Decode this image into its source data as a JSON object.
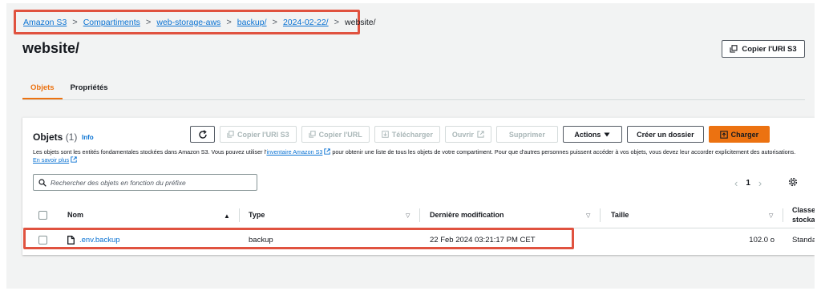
{
  "breadcrumb": {
    "items": [
      "Amazon S3",
      "Compartiments",
      "web-storage-aws",
      "backup/",
      "2024-02-22/"
    ],
    "current": "website/",
    "separator": ">"
  },
  "header": {
    "title": "website/",
    "copy_uri_label": "Copier l'URI S3"
  },
  "tabs": [
    {
      "label": "Objets",
      "active": true
    },
    {
      "label": "Propriétés",
      "active": false
    }
  ],
  "objects_panel": {
    "title": "Objets",
    "count": "(1)",
    "info_label": "Info",
    "description_before": "Les objets sont les entités fondamentales stockées dans Amazon S3. Vous pouvez utiliser l'",
    "inventory_link": "inventaire Amazon S3",
    "description_after": " pour obtenir une liste de tous les objets de votre compartiment. Pour que d'autres personnes puissent accéder à vos objets, vous devez leur accorder explicitement des autorisations.",
    "learn_more": "En savoir plus",
    "toolbar": {
      "copy_uri": "Copier l'URI S3",
      "copy_url": "Copier l'URL",
      "download": "Télécharger",
      "open": "Ouvrir",
      "delete": "Supprimer",
      "actions": "Actions",
      "create_folder": "Créer un dossier",
      "upload": "Charger"
    },
    "search_placeholder": "Rechercher des objets en fonction du préfixe",
    "pagination": {
      "current_page": "1"
    },
    "columns": [
      "Nom",
      "Type",
      "Dernière modification",
      "Taille",
      "Classe de stockage"
    ],
    "columns_display": {
      "storage_line1": "Classe",
      "storage_line2": "stocka"
    },
    "rows": [
      {
        "name": ".env.backup",
        "type": "backup",
        "modified": "22 Feb 2024 03:21:17 PM CET",
        "size": "102.0 o",
        "storage": "Standa"
      }
    ]
  },
  "colors": {
    "accent": "#ec7211",
    "link": "#0972d3",
    "highlight_box": "#e0523f"
  }
}
